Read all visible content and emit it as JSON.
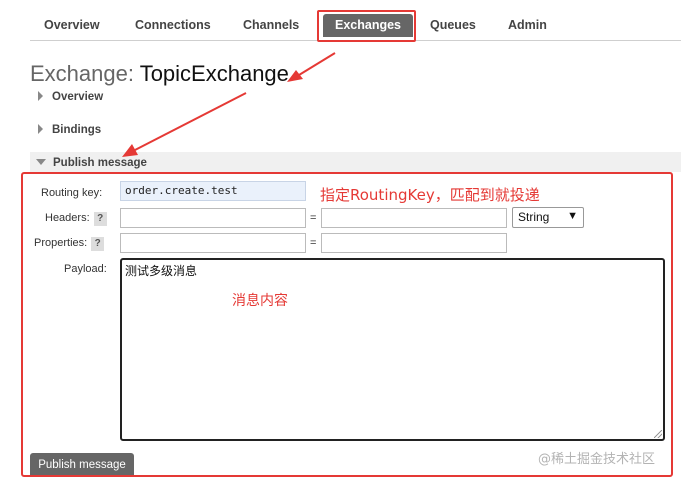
{
  "nav": {
    "tabs": [
      {
        "label": "Overview"
      },
      {
        "label": "Connections"
      },
      {
        "label": "Channels"
      },
      {
        "label": "Exchanges",
        "active": true
      },
      {
        "label": "Queues"
      },
      {
        "label": "Admin"
      }
    ]
  },
  "page": {
    "title_label": "Exchange:",
    "title_value": "TopicExchange"
  },
  "sections": {
    "overview": "Overview",
    "bindings": "Bindings",
    "publish": "Publish message"
  },
  "form": {
    "routing_key_label": "Routing key:",
    "routing_key_value": "order.create.test",
    "headers_label": "Headers:",
    "properties_label": "Properties:",
    "payload_label": "Payload:",
    "help_glyph": "?",
    "equals": "=",
    "header_type": "String",
    "payload_value": "测试多级消息",
    "publish_button": "Publish message"
  },
  "annotations": {
    "routing_note": "指定RoutingKey，匹配到就投递",
    "payload_note": "消息内容",
    "highlight_color": "#e53935"
  },
  "watermark": "@稀土掘金技术社区",
  "colors": {
    "active_tab_bg": "#666666",
    "section_header_bg": "#f0f0f0",
    "routing_input_bg": "#eaf1fb"
  }
}
